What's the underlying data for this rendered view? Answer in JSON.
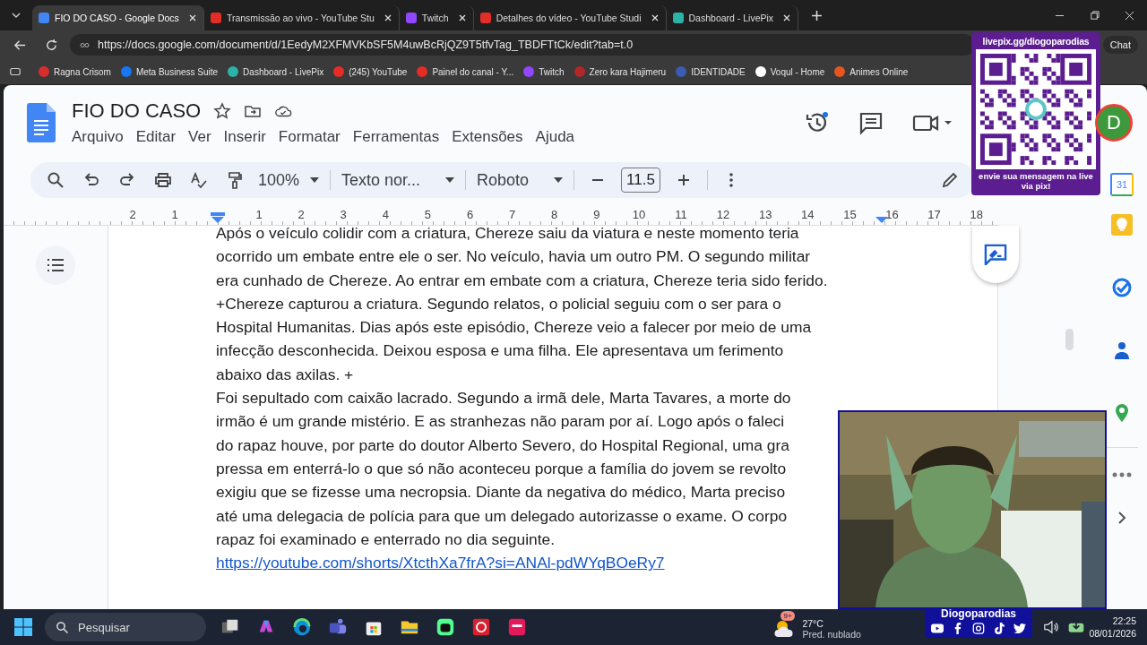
{
  "browser": {
    "tabs": [
      {
        "title": "FIO DO CASO - Google Docs",
        "selected": true,
        "color": "#4285f4"
      },
      {
        "title": "Transmissão ao vivo - YouTube Stu",
        "selected": false,
        "color": "#e52d27"
      },
      {
        "title": "Twitch",
        "selected": false,
        "color": "#9146ff"
      },
      {
        "title": "Detalhes do vídeo - YouTube Studi",
        "selected": false,
        "color": "#e52d27"
      },
      {
        "title": "Dashboard - LivePix",
        "selected": false,
        "color": "#2bb3a8"
      }
    ],
    "address": "https://docs.google.com/document/d/1EedyM2XFMVKbSF5M4uwBcRjQZ9T5tfvTag_TBDFTtCk/edit?tab=t.0",
    "chat": "Chat",
    "bookmarks": [
      {
        "label": "Ragna Crisom",
        "color": "#d92d2d"
      },
      {
        "label": "Meta Business Suite",
        "color": "#1877f2"
      },
      {
        "label": "Dashboard - LivePix",
        "color": "#2bb3a8"
      },
      {
        "label": "(245) YouTube",
        "color": "#e52d27"
      },
      {
        "label": "Painel do canal - Y...",
        "color": "#e52d27"
      },
      {
        "label": "Twitch",
        "color": "#9146ff"
      },
      {
        "label": "Zero kara Hajimeru",
        "color": "#b3262a"
      },
      {
        "label": "IDENTIDADE",
        "color": "#3b5bb5"
      },
      {
        "label": "Voqul - Home",
        "color": "#ffffff"
      },
      {
        "label": "Animes Online",
        "color": "#e8541e"
      }
    ]
  },
  "docs": {
    "title": "FIO DO CASO",
    "avatar": "D",
    "menus": [
      "Arquivo",
      "Editar",
      "Ver",
      "Inserir",
      "Formatar",
      "Ferramentas",
      "Extensões",
      "Ajuda"
    ],
    "toolbar": {
      "zoom": "100%",
      "style": "Texto nor...",
      "font": "Roboto",
      "size": "11.5"
    },
    "ruler": [
      "2",
      "1",
      "1",
      "2",
      "3",
      "4",
      "5",
      "6",
      "7",
      "8",
      "9",
      "10",
      "11",
      "12",
      "13",
      "14",
      "15",
      "16",
      "17",
      "18"
    ],
    "lines": [
      "Após o veículo colidir com a criatura, Chereze saiu da viatura e neste momento teria",
      "ocorrido um embate entre ele o ser. No veículo, havia um outro PM. O segundo militar",
      "era cunhado de Chereze. Ao entrar em embate com a criatura, Chereze teria sido ferido.",
      "+Chereze capturou a criatura. Segundo relatos, o policial seguiu com o ser para o",
      "Hospital Humanitas. Dias após este episódio, Chereze veio a falecer por meio de uma",
      "infecção desconhecida. Deixou esposa e uma filha. Ele apresentava um ferimento",
      "abaixo das axilas. +",
      "Foi sepultado com caixão lacrado. Segundo a irmã dele, Marta Tavares, a morte do",
      "irmão é um grande mistério. E as stranhezas não param por aí. Logo após o faleci",
      "do rapaz houve, por parte do doutor Alberto Severo, do Hospital Regional, uma gra",
      "pressa em enterrá-lo o que só não aconteceu porque a família do jovem se revolto",
      "exigiu que se fizesse uma necropsia. Diante da negativa do médico, Marta preciso",
      "até uma delegacia de polícia para que um delegado autorizasse o exame. O corpo",
      "rapaz foi examinado e enterrado no dia seguinte."
    ],
    "link": "https://youtube.com/shorts/XtcthXa7frA?si=ANAl-pdWYqBOeRy7",
    "calendar_day": "31"
  },
  "overlay": {
    "qr_top": "livepix.gg/diogoparodias",
    "qr_bottom": "envie sua mensagem na live via pix!",
    "name": "Diogoparodias"
  },
  "taskbar": {
    "search": "Pesquisar",
    "badge": "9+",
    "temperature": "27°C",
    "weather": "Pred. nublado",
    "time": "22:25",
    "date": "08/01/2026"
  }
}
